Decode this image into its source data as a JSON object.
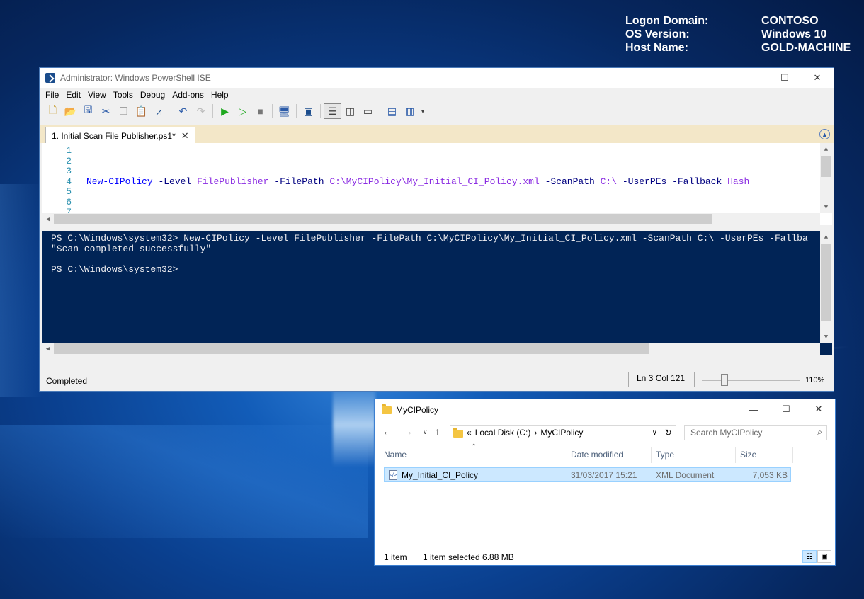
{
  "bginfo": [
    {
      "key": "Logon Domain:",
      "value": "CONTOSO"
    },
    {
      "key": "OS Version:",
      "value": "Windows 10"
    },
    {
      "key": "Host Name:",
      "value": "GOLD-MACHINE"
    }
  ],
  "ise": {
    "title": "Administrator: Windows PowerShell ISE",
    "menu": [
      "File",
      "Edit",
      "View",
      "Tools",
      "Debug",
      "Add-ons",
      "Help"
    ],
    "tab_label": "1. Initial Scan File Publisher.ps1*",
    "line_numbers": "1\n2\n3\n4\n5\n6\n7",
    "script": {
      "cmdlet": "New-CIPolicy",
      "p1": "-Level",
      "a1": "FilePublisher",
      "p2": "-FilePath",
      "a2": "C:\\MyCIPolicy\\My_Initial_CI_Policy.xml",
      "p3": "-ScanPath",
      "a3": "C:\\",
      "p4": "-UserPEs",
      "p5": "-Fallback",
      "a5": "Hash"
    },
    "console_text": "PS C:\\Windows\\system32> New-CIPolicy -Level FilePublisher -FilePath C:\\MyCIPolicy\\My_Initial_CI_Policy.xml -ScanPath C:\\ -UserPEs -Fallba\n\"Scan completed successfully\"\n\nPS C:\\Windows\\system32>",
    "status": "Completed",
    "position": "Ln 3  Col 121",
    "zoom": "110%"
  },
  "explorer": {
    "title": "MyCIPolicy",
    "breadcrumb_prefix": "«",
    "breadcrumb": [
      "Local Disk (C:)",
      "MyCIPolicy"
    ],
    "search_placeholder": "Search MyCIPolicy",
    "columns": [
      "Name",
      "Date modified",
      "Type",
      "Size"
    ],
    "files": [
      {
        "name": "My_Initial_CI_Policy",
        "date": "31/03/2017 15:21",
        "type": "XML Document",
        "size": "7,053 KB"
      }
    ],
    "status_count": "1 item",
    "status_selected": "1 item selected  6.88 MB"
  }
}
